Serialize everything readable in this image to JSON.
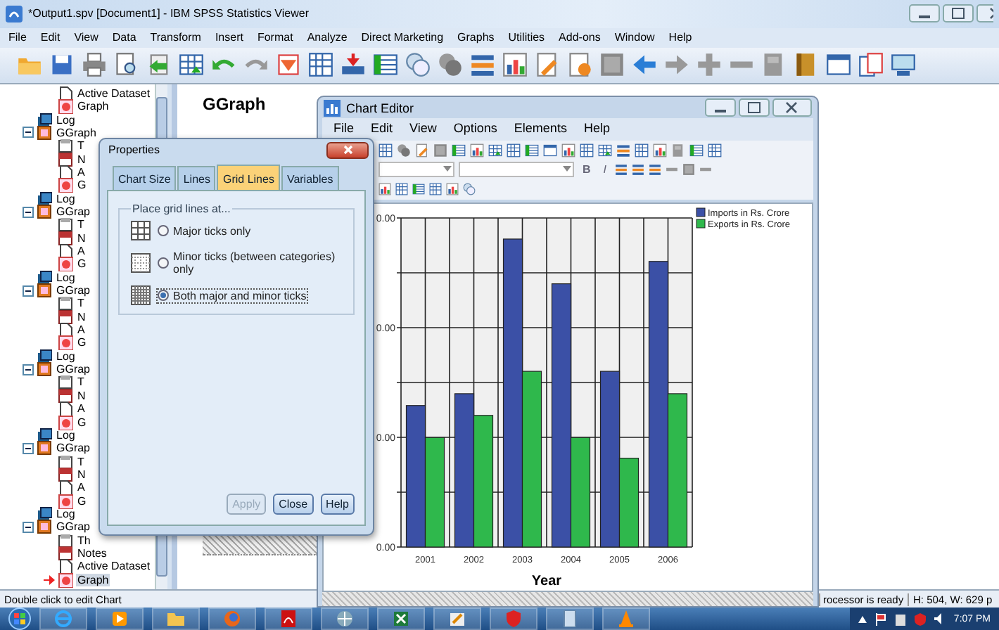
{
  "window": {
    "title": "*Output1.spv [Document1] - IBM SPSS Statistics Viewer"
  },
  "menu": [
    "File",
    "Edit",
    "View",
    "Data",
    "Transform",
    "Insert",
    "Format",
    "Analyze",
    "Direct Marketing",
    "Graphs",
    "Utilities",
    "Add-ons",
    "Window",
    "Help"
  ],
  "outline": {
    "items": [
      {
        "label": "Active Dataset",
        "kind": "dataset",
        "selected": false
      },
      {
        "label": "Graph",
        "kind": "chart",
        "selected": false
      },
      {
        "label": "Log",
        "kind": "log",
        "selected": false
      },
      {
        "label": "GGraph",
        "kind": "procedure",
        "selected": false,
        "expanded": true,
        "children": [
          {
            "label": "T",
            "kind": "title",
            "selected": false
          },
          {
            "label": "N",
            "kind": "notes",
            "selected": false
          },
          {
            "label": "A",
            "kind": "dataset",
            "selected": false
          },
          {
            "label": "G",
            "kind": "chart",
            "selected": false
          }
        ]
      },
      {
        "label": "Log",
        "kind": "log",
        "selected": false
      },
      {
        "label": "GGrap",
        "kind": "procedure",
        "selected": false,
        "expanded": true,
        "children": [
          {
            "label": "T",
            "kind": "title",
            "selected": false
          },
          {
            "label": "N",
            "kind": "notes",
            "selected": false
          },
          {
            "label": "A",
            "kind": "dataset",
            "selected": false
          },
          {
            "label": "G",
            "kind": "chart",
            "selected": false
          }
        ]
      },
      {
        "label": "Log",
        "kind": "log",
        "selected": false
      },
      {
        "label": "GGrap",
        "kind": "procedure",
        "selected": false,
        "expanded": true,
        "children": [
          {
            "label": "T",
            "kind": "title",
            "selected": false
          },
          {
            "label": "N",
            "kind": "notes",
            "selected": false
          },
          {
            "label": "A",
            "kind": "dataset",
            "selected": false
          },
          {
            "label": "G",
            "kind": "chart",
            "selected": false
          }
        ]
      },
      {
        "label": "Log",
        "kind": "log",
        "selected": false
      },
      {
        "label": "GGrap",
        "kind": "procedure",
        "selected": false,
        "expanded": true,
        "children": [
          {
            "label": "T",
            "kind": "title",
            "selected": false
          },
          {
            "label": "N",
            "kind": "notes",
            "selected": false
          },
          {
            "label": "A",
            "kind": "dataset",
            "selected": false
          },
          {
            "label": "G",
            "kind": "chart",
            "selected": false
          }
        ]
      },
      {
        "label": "Log",
        "kind": "log",
        "selected": false
      },
      {
        "label": "GGrap",
        "kind": "procedure",
        "selected": false,
        "expanded": true,
        "children": [
          {
            "label": "T",
            "kind": "title",
            "selected": false
          },
          {
            "label": "N",
            "kind": "notes",
            "selected": false
          },
          {
            "label": "A",
            "kind": "dataset",
            "selected": false
          },
          {
            "label": "G",
            "kind": "chart",
            "selected": false
          }
        ]
      },
      {
        "label": "Log",
        "kind": "log",
        "selected": false
      },
      {
        "label": "GGrap",
        "kind": "procedure",
        "selected": false,
        "expanded": true,
        "children": [
          {
            "label": "Th",
            "kind": "title",
            "selected": false
          },
          {
            "label": "Notes",
            "kind": "notes",
            "selected": false
          },
          {
            "label": "Active Dataset",
            "kind": "dataset",
            "selected": false
          },
          {
            "label": "Graph",
            "kind": "chart",
            "selected": true
          }
        ]
      }
    ]
  },
  "content": {
    "heading": "GGraph"
  },
  "chart_editor": {
    "title": "Chart Editor",
    "menu": [
      "File",
      "Edit",
      "View",
      "Options",
      "Elements",
      "Help"
    ],
    "format_buttons": [
      "B",
      "I"
    ],
    "chart": {
      "y_tick_labels": [
        "0.00",
        "0.00",
        "0.00",
        "0.00"
      ],
      "categories": [
        "2001",
        "2002",
        "2003",
        "2004",
        "2005",
        "2006"
      ],
      "xlabel": "Year",
      "series": [
        {
          "name": "Imports in Rs. Crore",
          "color": "#3b50a6"
        },
        {
          "name": "Exports in Rs. Crore",
          "color": "#2fb84c"
        }
      ]
    }
  },
  "properties": {
    "title": "Properties",
    "tabs": [
      {
        "label": "Chart Size",
        "selected": false
      },
      {
        "label": "Lines",
        "selected": false
      },
      {
        "label": "Grid Lines",
        "selected": true
      },
      {
        "label": "Variables",
        "selected": false
      }
    ],
    "group_label": "Place grid lines at...",
    "options": [
      {
        "label": "Major ticks only",
        "kind": "major",
        "selected": false
      },
      {
        "label": "Minor ticks (between categories) only",
        "kind": "minor",
        "selected": false
      },
      {
        "label": "Both major and minor ticks",
        "kind": "both",
        "selected": true
      }
    ],
    "buttons": [
      {
        "label": "Apply",
        "disabled": true
      },
      {
        "label": "Close",
        "disabled": false
      },
      {
        "label": "Help",
        "disabled": false
      }
    ]
  },
  "status_bar": {
    "message": "Double click to edit Chart",
    "processor": "rocessor is ready",
    "size": "H: 504, W: 629 p"
  },
  "taskbar": {
    "time": "7:07 PM"
  }
}
